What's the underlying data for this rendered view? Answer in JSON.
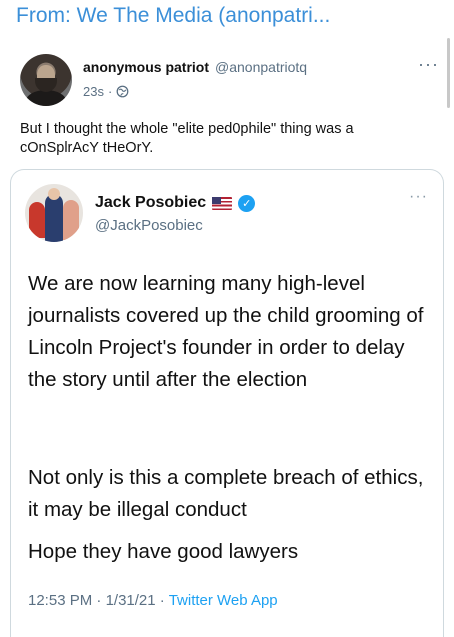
{
  "header": {
    "from_label": "From: We The Media (anonpatri..."
  },
  "outer_tweet": {
    "display_name": "anonymous patriot",
    "handle": "@anonpatriotq",
    "time": "23s",
    "separator": "·",
    "more": "···",
    "text": "But I thought the whole \"elite ped0phile\" thing was a cOnSplrAcY tHeOrY."
  },
  "quoted_tweet": {
    "display_name": "Jack Posobiec",
    "handle": "@JackPosobiec",
    "more": "···",
    "paragraphs": [
      "We are now learning many high-level journalists covered up the child grooming of Lincoln Project's founder in order to delay the story until after the election",
      "Not only is this a complete breach of ethics, it may be illegal conduct",
      "Hope they have good lawyers"
    ],
    "time": "12:53 PM",
    "date": "1/31/21",
    "separator": "·",
    "source": "Twitter Web App"
  },
  "colors": {
    "accent": "#1da1f2",
    "header": "#3b8fd8",
    "muted": "#5b7083"
  },
  "icons": {
    "globe": "globe-icon",
    "verified": "verified-badge-icon",
    "flag": "us-flag-icon"
  }
}
